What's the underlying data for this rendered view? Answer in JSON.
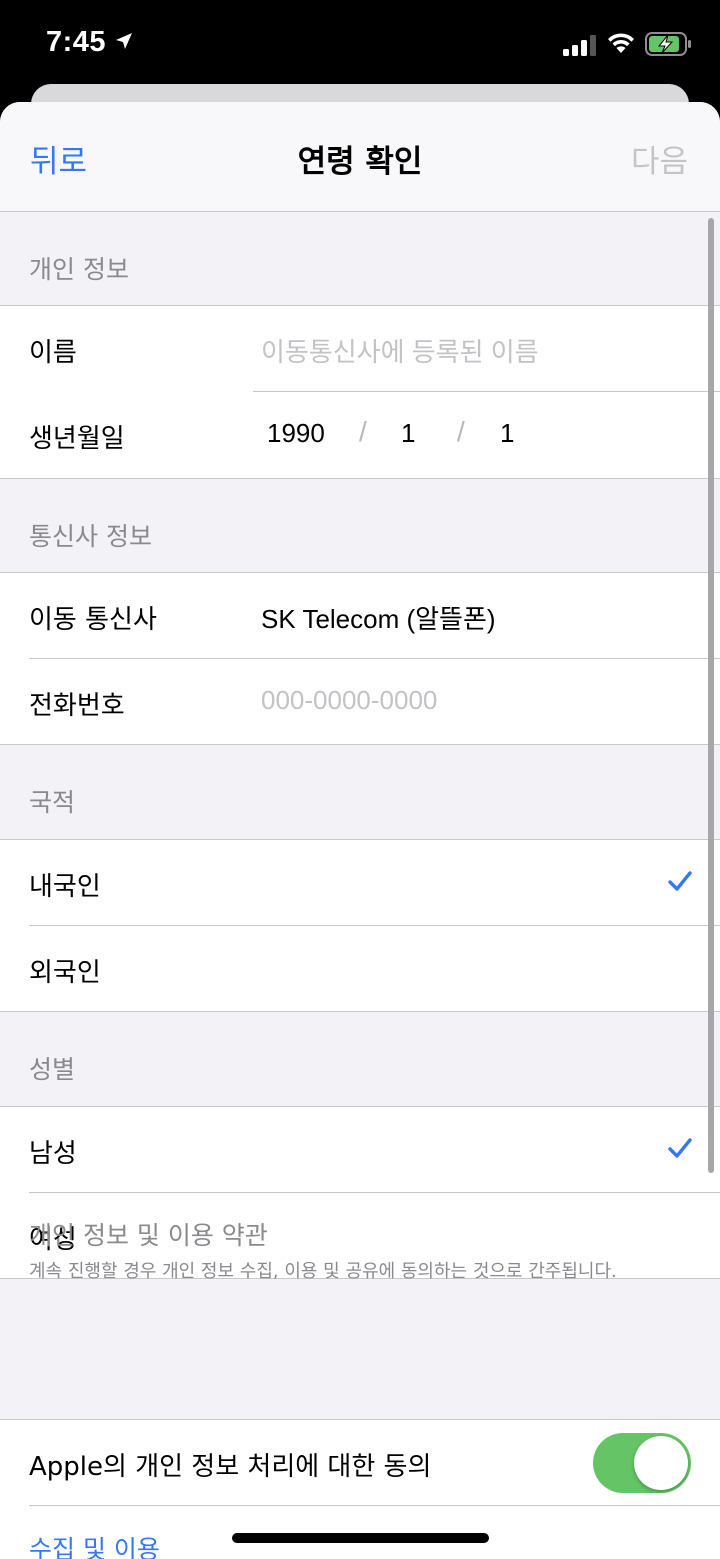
{
  "status_bar": {
    "time": "7:45"
  },
  "nav": {
    "back": "뒤로",
    "title": "연령 확인",
    "next": "다음"
  },
  "sections": {
    "personal_info": {
      "header": "개인 정보",
      "name_label": "이름",
      "name_placeholder": "이동통신사에 등록된 이름",
      "dob_label": "생년월일",
      "dob_year": "1990",
      "dob_month": "1",
      "dob_day": "1",
      "dob_sep": "/"
    },
    "carrier_info": {
      "header": "통신사 정보",
      "carrier_label": "이동 통신사",
      "carrier_value": "SK Telecom (알뜰폰)",
      "phone_label": "전화번호",
      "phone_placeholder": "000-0000-0000"
    },
    "nationality": {
      "header": "국적",
      "options": [
        {
          "label": "내국인",
          "selected": true
        },
        {
          "label": "외국인",
          "selected": false
        }
      ]
    },
    "gender": {
      "header": "성별",
      "options": [
        {
          "label": "남성",
          "selected": true
        },
        {
          "label": "여성",
          "selected": false
        }
      ]
    },
    "terms": {
      "title": "개인 정보 및 이용 약관",
      "description": "계속 진행할 경우 개인 정보 수집, 이용 및 공유에 동의하는 것으로 간주됩니다.",
      "apple_consent_label": "Apple의 개인 정보 처리에 대한 동의",
      "apple_consent_on": true,
      "collection_link": "수집 및 이용"
    }
  },
  "colors": {
    "accent": "#3478f6",
    "toggle_on": "#65c466",
    "secondary_text": "#8a8a8e"
  }
}
